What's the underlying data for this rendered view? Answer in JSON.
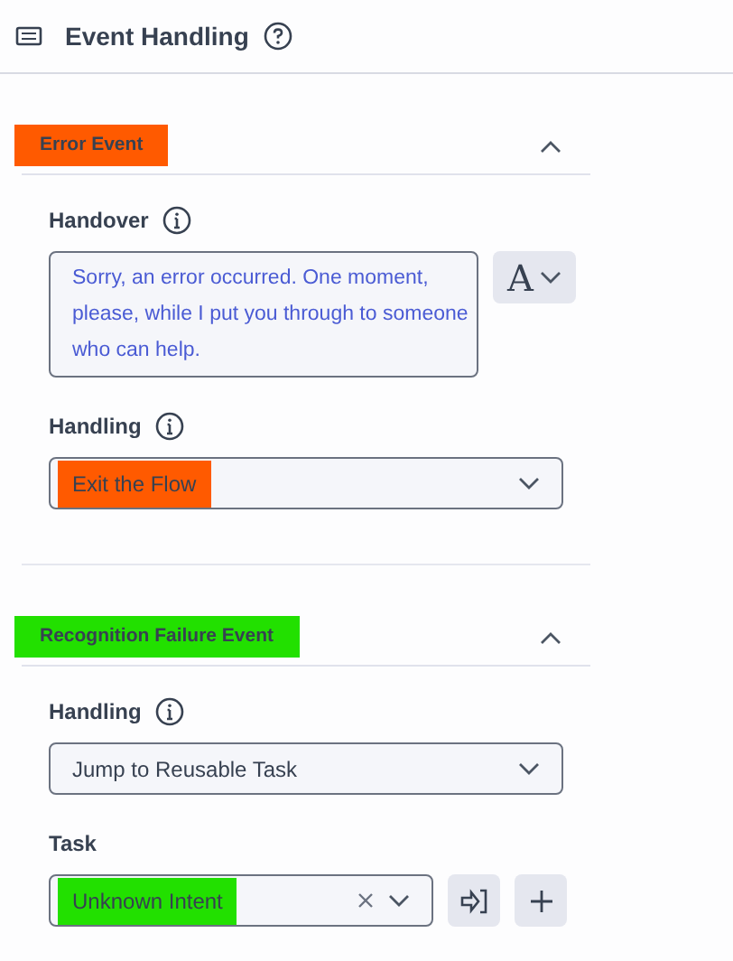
{
  "header": {
    "title": "Event Handling"
  },
  "sections": [
    {
      "title": "Error Event",
      "color": "#ff5a00",
      "expanded": true,
      "fields": [
        {
          "kind": "textarea",
          "label": "Handover",
          "info": true,
          "value": "Sorry, an error occurred. One moment, please, while I put you through to someone who can help.",
          "side_button": "A"
        },
        {
          "kind": "select",
          "label": "Handling",
          "info": true,
          "value": "Exit the Flow",
          "color": "#ff5a00"
        }
      ]
    },
    {
      "title": "Recognition Failure Event",
      "color": "#22e000",
      "expanded": true,
      "fields": [
        {
          "kind": "select",
          "label": "Handling",
          "info": true,
          "value": "Jump to Reusable Task"
        },
        {
          "kind": "task",
          "label": "Task",
          "info": false,
          "value": "Unknown Intent",
          "color": "#22e000"
        }
      ]
    }
  ]
}
